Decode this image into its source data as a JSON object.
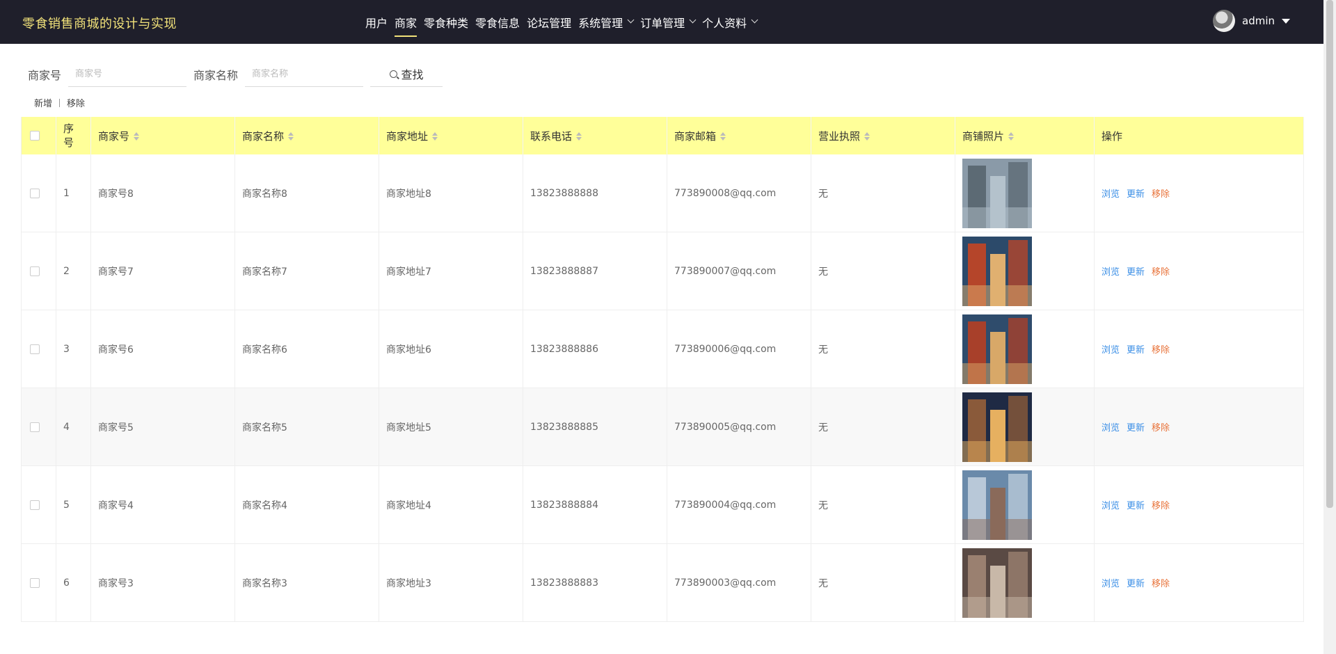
{
  "header": {
    "title": "零食销售商城的设计与实现",
    "nav": [
      {
        "label": "用户",
        "active": false,
        "dropdown": false
      },
      {
        "label": "商家",
        "active": true,
        "dropdown": false
      },
      {
        "label": "零食种类",
        "active": false,
        "dropdown": false
      },
      {
        "label": "零食信息",
        "active": false,
        "dropdown": false
      },
      {
        "label": "论坛管理",
        "active": false,
        "dropdown": false
      },
      {
        "label": "系统管理",
        "active": false,
        "dropdown": true
      },
      {
        "label": "订单管理",
        "active": false,
        "dropdown": true
      },
      {
        "label": "个人资料",
        "active": false,
        "dropdown": true
      }
    ],
    "user": "admin"
  },
  "search": {
    "merchant_no_label": "商家号",
    "merchant_no_placeholder": "商家号",
    "merchant_name_label": "商家名称",
    "merchant_name_placeholder": "商家名称",
    "search_button": "查找"
  },
  "actions": {
    "add": "新增",
    "remove": "移除"
  },
  "table": {
    "columns": [
      "序号",
      "商家号",
      "商家名称",
      "商家地址",
      "联系电话",
      "商家邮箱",
      "营业执照",
      "商铺照片",
      "操作"
    ],
    "row_actions": {
      "view": "浏览",
      "update": "更新",
      "remove": "移除"
    },
    "rows": [
      {
        "index": "1",
        "no": "商家号8",
        "name": "商家名称8",
        "address": "商家地址8",
        "phone": "13823888888",
        "email": "773890008@qq.com",
        "license": "无"
      },
      {
        "index": "2",
        "no": "商家号7",
        "name": "商家名称7",
        "address": "商家地址7",
        "phone": "13823888887",
        "email": "773890007@qq.com",
        "license": "无"
      },
      {
        "index": "3",
        "no": "商家号6",
        "name": "商家名称6",
        "address": "商家地址6",
        "phone": "13823888886",
        "email": "773890006@qq.com",
        "license": "无"
      },
      {
        "index": "4",
        "no": "商家号5",
        "name": "商家名称5",
        "address": "商家地址5",
        "phone": "13823888885",
        "email": "773890005@qq.com",
        "license": "无"
      },
      {
        "index": "5",
        "no": "商家号4",
        "name": "商家名称4",
        "address": "商家地址4",
        "phone": "13823888884",
        "email": "773890004@qq.com",
        "license": "无"
      },
      {
        "index": "6",
        "no": "商家号3",
        "name": "商家名称3",
        "address": "商家地址3",
        "phone": "13823888883",
        "email": "773890003@qq.com",
        "license": "无"
      }
    ]
  },
  "colors": {
    "topbar": "#1f1f2b",
    "title": "#f2e27a",
    "table_header": "#ffff99",
    "link": "#3a8ee6",
    "danger": "#e8733a"
  }
}
